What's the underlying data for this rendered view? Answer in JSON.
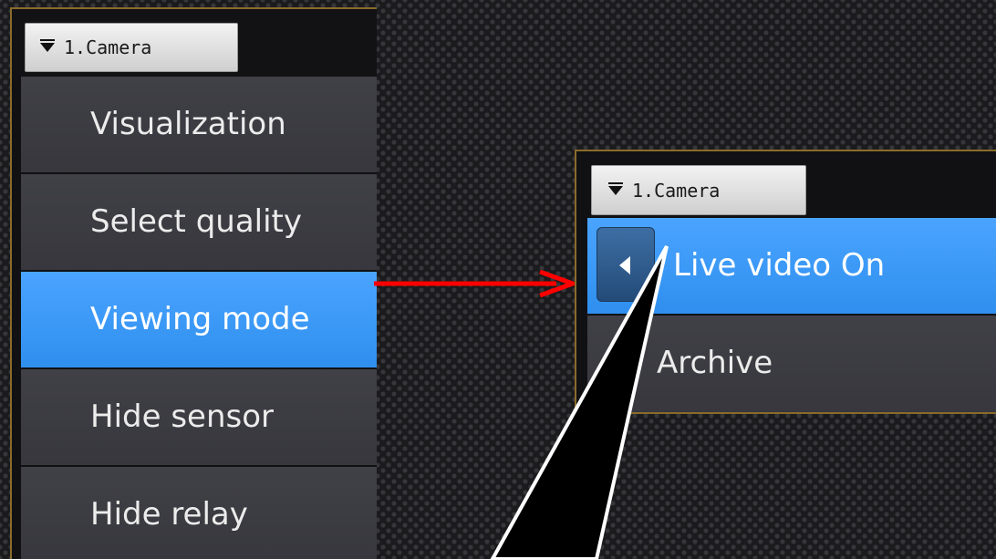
{
  "left_panel": {
    "camera_button_label": "1.Camera",
    "menu_items": [
      {
        "label": "Visualization"
      },
      {
        "label": "Select quality"
      },
      {
        "label": "Viewing mode"
      },
      {
        "label": "Hide sensor"
      },
      {
        "label": "Hide relay"
      }
    ],
    "active_item": "Viewing mode"
  },
  "right_panel": {
    "camera_button_label": "1.Camera",
    "menu_items": [
      {
        "label": "Live video On"
      },
      {
        "label": "Archive"
      }
    ],
    "active_item": "Live video On"
  },
  "colors": {
    "accent_blue": "#3a96f5",
    "menu_gray": "#3c3c42",
    "border_gold": "#8a6b2a",
    "arrow_red": "#ff0000"
  },
  "icons": {
    "camera_dropdown": "chevron-down-icon",
    "back": "arrow-left-icon"
  }
}
